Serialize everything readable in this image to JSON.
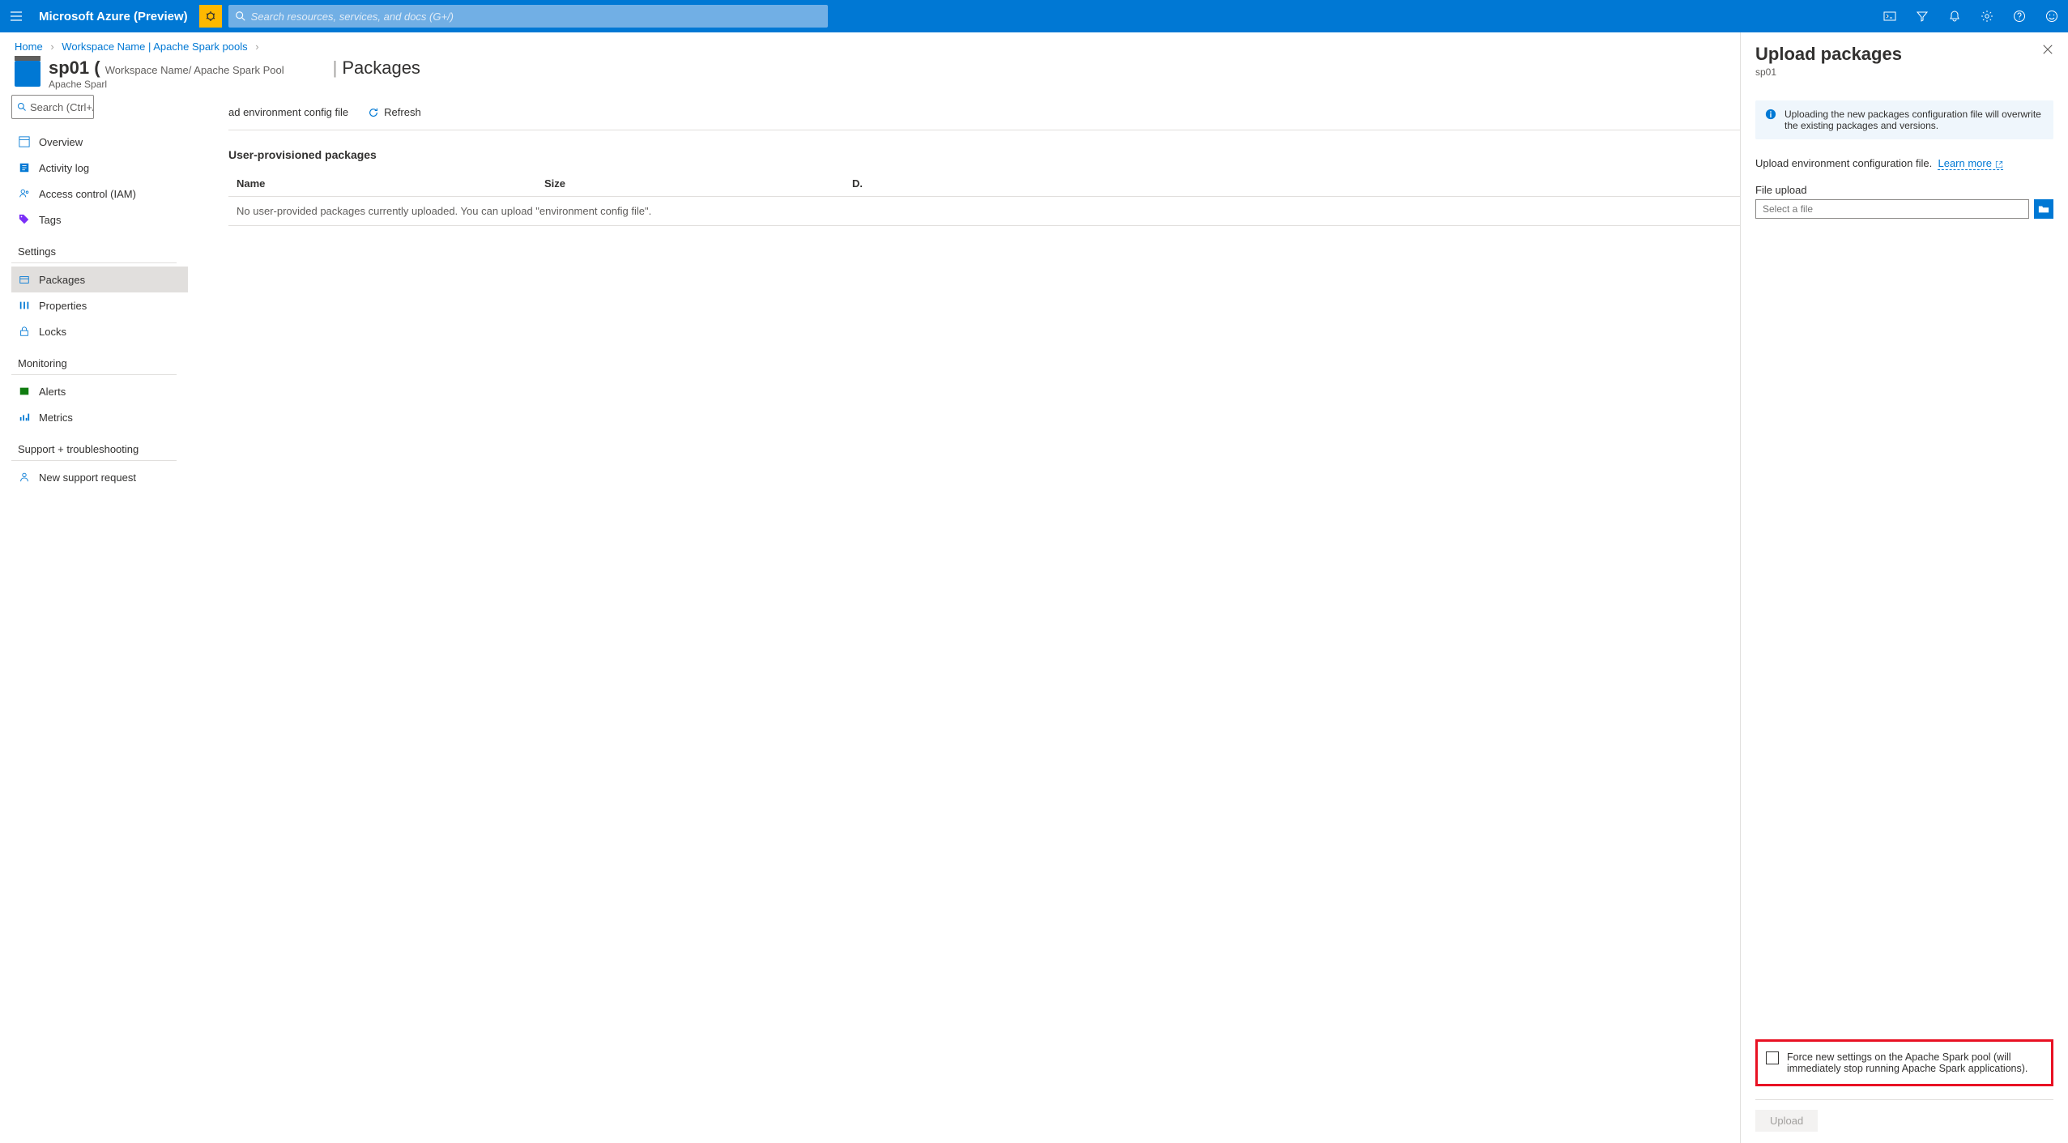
{
  "topbar": {
    "brand": "Microsoft Azure (Preview)",
    "search_placeholder": "Search resources, services, and docs (G+/)"
  },
  "breadcrumb": {
    "home": "Home",
    "workspace": "Workspace Name | Apache Spark pools"
  },
  "header": {
    "pool_name": "sp01 (",
    "pool_path": "Workspace Name/ Apache Spark Pool",
    "subline": "Apache Sparl",
    "section": "Packages"
  },
  "leftnav": {
    "search_placeholder": "Search (Ctrl+/)",
    "items_top": [
      {
        "label": "Overview",
        "icon": "overview"
      },
      {
        "label": "Activity log",
        "icon": "activity"
      },
      {
        "label": "Access control (IAM)",
        "icon": "iam"
      },
      {
        "label": "Tags",
        "icon": "tags"
      }
    ],
    "group_settings": "Settings",
    "items_settings": [
      {
        "label": "Packages",
        "icon": "packages",
        "active": true
      },
      {
        "label": "Properties",
        "icon": "properties"
      },
      {
        "label": "Locks",
        "icon": "locks"
      }
    ],
    "group_monitoring": "Monitoring",
    "items_monitoring": [
      {
        "label": "Alerts",
        "icon": "alerts"
      },
      {
        "label": "Metrics",
        "icon": "metrics"
      }
    ],
    "group_support": "Support + troubleshooting",
    "items_support": [
      {
        "label": "New support request",
        "icon": "support"
      }
    ]
  },
  "toolbar": {
    "env_config": "ad environment config file",
    "refresh": "Refresh"
  },
  "main": {
    "section_title": "User-provisioned packages",
    "th_name": "Name",
    "th_size": "Size",
    "th_date": "D.",
    "empty_row": "No user-provided packages currently uploaded. You can upload \"environment config file\"."
  },
  "panel": {
    "title": "Upload packages",
    "subname": "sp01",
    "info": "Uploading the new packages configuration file will overwrite the existing packages and versions.",
    "text": "Upload environment configuration file.",
    "learn_more": "Learn more",
    "file_label": "File upload",
    "file_placeholder": "Select a file",
    "force_text": "Force new settings on the Apache Spark pool (will immediately stop running Apache Spark applications).",
    "upload_btn": "Upload"
  }
}
